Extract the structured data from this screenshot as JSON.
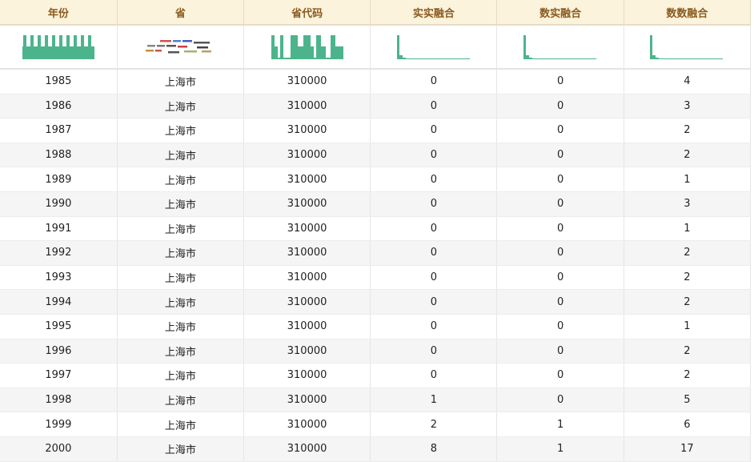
{
  "columns": [
    "年份",
    "省",
    "省代码",
    "实实融合",
    "数实融合",
    "数数融合"
  ],
  "colors": {
    "spark": "#4cb48c",
    "header_bg": "#fcf3dc",
    "header_text": "#8a5a1f"
  },
  "rows": [
    [
      "1985",
      "上海市",
      "310000",
      "0",
      "0",
      "4"
    ],
    [
      "1986",
      "上海市",
      "310000",
      "0",
      "0",
      "3"
    ],
    [
      "1987",
      "上海市",
      "310000",
      "0",
      "0",
      "2"
    ],
    [
      "1988",
      "上海市",
      "310000",
      "0",
      "0",
      "2"
    ],
    [
      "1989",
      "上海市",
      "310000",
      "0",
      "0",
      "1"
    ],
    [
      "1990",
      "上海市",
      "310000",
      "0",
      "0",
      "3"
    ],
    [
      "1991",
      "上海市",
      "310000",
      "0",
      "0",
      "1"
    ],
    [
      "1992",
      "上海市",
      "310000",
      "0",
      "0",
      "2"
    ],
    [
      "1993",
      "上海市",
      "310000",
      "0",
      "0",
      "2"
    ],
    [
      "1994",
      "上海市",
      "310000",
      "0",
      "0",
      "2"
    ],
    [
      "1995",
      "上海市",
      "310000",
      "0",
      "0",
      "1"
    ],
    [
      "1996",
      "上海市",
      "310000",
      "0",
      "0",
      "2"
    ],
    [
      "1997",
      "上海市",
      "310000",
      "0",
      "0",
      "2"
    ],
    [
      "1998",
      "上海市",
      "310000",
      "1",
      "0",
      "5"
    ],
    [
      "1999",
      "上海市",
      "310000",
      "2",
      "1",
      "6"
    ],
    [
      "2000",
      "上海市",
      "310000",
      "8",
      "1",
      "17"
    ]
  ]
}
